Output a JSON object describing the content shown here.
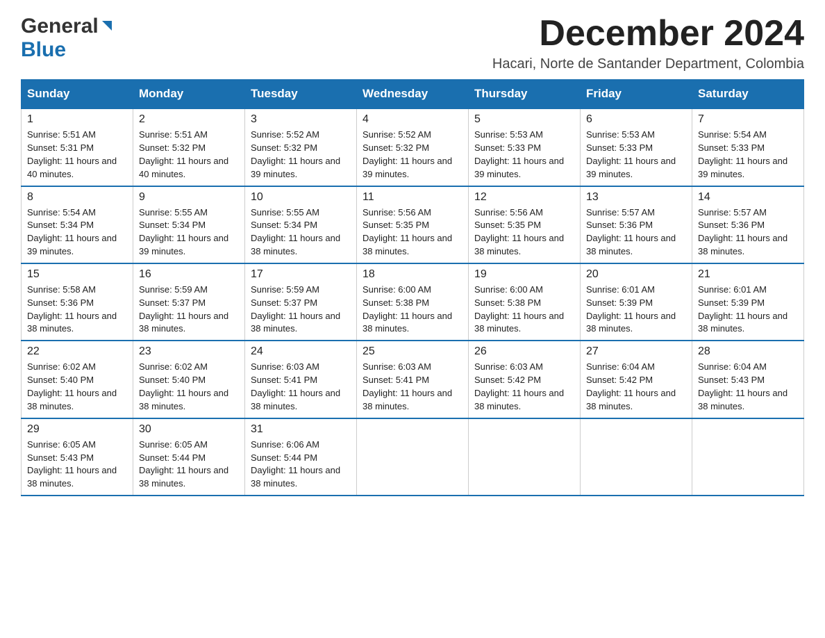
{
  "header": {
    "logo_line1": "General",
    "logo_line2": "Blue",
    "month_title": "December 2024",
    "location": "Hacari, Norte de Santander Department, Colombia"
  },
  "weekdays": [
    "Sunday",
    "Monday",
    "Tuesday",
    "Wednesday",
    "Thursday",
    "Friday",
    "Saturday"
  ],
  "weeks": [
    [
      {
        "day": "1",
        "sunrise": "Sunrise: 5:51 AM",
        "sunset": "Sunset: 5:31 PM",
        "daylight": "Daylight: 11 hours and 40 minutes."
      },
      {
        "day": "2",
        "sunrise": "Sunrise: 5:51 AM",
        "sunset": "Sunset: 5:32 PM",
        "daylight": "Daylight: 11 hours and 40 minutes."
      },
      {
        "day": "3",
        "sunrise": "Sunrise: 5:52 AM",
        "sunset": "Sunset: 5:32 PM",
        "daylight": "Daylight: 11 hours and 39 minutes."
      },
      {
        "day": "4",
        "sunrise": "Sunrise: 5:52 AM",
        "sunset": "Sunset: 5:32 PM",
        "daylight": "Daylight: 11 hours and 39 minutes."
      },
      {
        "day": "5",
        "sunrise": "Sunrise: 5:53 AM",
        "sunset": "Sunset: 5:33 PM",
        "daylight": "Daylight: 11 hours and 39 minutes."
      },
      {
        "day": "6",
        "sunrise": "Sunrise: 5:53 AM",
        "sunset": "Sunset: 5:33 PM",
        "daylight": "Daylight: 11 hours and 39 minutes."
      },
      {
        "day": "7",
        "sunrise": "Sunrise: 5:54 AM",
        "sunset": "Sunset: 5:33 PM",
        "daylight": "Daylight: 11 hours and 39 minutes."
      }
    ],
    [
      {
        "day": "8",
        "sunrise": "Sunrise: 5:54 AM",
        "sunset": "Sunset: 5:34 PM",
        "daylight": "Daylight: 11 hours and 39 minutes."
      },
      {
        "day": "9",
        "sunrise": "Sunrise: 5:55 AM",
        "sunset": "Sunset: 5:34 PM",
        "daylight": "Daylight: 11 hours and 39 minutes."
      },
      {
        "day": "10",
        "sunrise": "Sunrise: 5:55 AM",
        "sunset": "Sunset: 5:34 PM",
        "daylight": "Daylight: 11 hours and 38 minutes."
      },
      {
        "day": "11",
        "sunrise": "Sunrise: 5:56 AM",
        "sunset": "Sunset: 5:35 PM",
        "daylight": "Daylight: 11 hours and 38 minutes."
      },
      {
        "day": "12",
        "sunrise": "Sunrise: 5:56 AM",
        "sunset": "Sunset: 5:35 PM",
        "daylight": "Daylight: 11 hours and 38 minutes."
      },
      {
        "day": "13",
        "sunrise": "Sunrise: 5:57 AM",
        "sunset": "Sunset: 5:36 PM",
        "daylight": "Daylight: 11 hours and 38 minutes."
      },
      {
        "day": "14",
        "sunrise": "Sunrise: 5:57 AM",
        "sunset": "Sunset: 5:36 PM",
        "daylight": "Daylight: 11 hours and 38 minutes."
      }
    ],
    [
      {
        "day": "15",
        "sunrise": "Sunrise: 5:58 AM",
        "sunset": "Sunset: 5:36 PM",
        "daylight": "Daylight: 11 hours and 38 minutes."
      },
      {
        "day": "16",
        "sunrise": "Sunrise: 5:59 AM",
        "sunset": "Sunset: 5:37 PM",
        "daylight": "Daylight: 11 hours and 38 minutes."
      },
      {
        "day": "17",
        "sunrise": "Sunrise: 5:59 AM",
        "sunset": "Sunset: 5:37 PM",
        "daylight": "Daylight: 11 hours and 38 minutes."
      },
      {
        "day": "18",
        "sunrise": "Sunrise: 6:00 AM",
        "sunset": "Sunset: 5:38 PM",
        "daylight": "Daylight: 11 hours and 38 minutes."
      },
      {
        "day": "19",
        "sunrise": "Sunrise: 6:00 AM",
        "sunset": "Sunset: 5:38 PM",
        "daylight": "Daylight: 11 hours and 38 minutes."
      },
      {
        "day": "20",
        "sunrise": "Sunrise: 6:01 AM",
        "sunset": "Sunset: 5:39 PM",
        "daylight": "Daylight: 11 hours and 38 minutes."
      },
      {
        "day": "21",
        "sunrise": "Sunrise: 6:01 AM",
        "sunset": "Sunset: 5:39 PM",
        "daylight": "Daylight: 11 hours and 38 minutes."
      }
    ],
    [
      {
        "day": "22",
        "sunrise": "Sunrise: 6:02 AM",
        "sunset": "Sunset: 5:40 PM",
        "daylight": "Daylight: 11 hours and 38 minutes."
      },
      {
        "day": "23",
        "sunrise": "Sunrise: 6:02 AM",
        "sunset": "Sunset: 5:40 PM",
        "daylight": "Daylight: 11 hours and 38 minutes."
      },
      {
        "day": "24",
        "sunrise": "Sunrise: 6:03 AM",
        "sunset": "Sunset: 5:41 PM",
        "daylight": "Daylight: 11 hours and 38 minutes."
      },
      {
        "day": "25",
        "sunrise": "Sunrise: 6:03 AM",
        "sunset": "Sunset: 5:41 PM",
        "daylight": "Daylight: 11 hours and 38 minutes."
      },
      {
        "day": "26",
        "sunrise": "Sunrise: 6:03 AM",
        "sunset": "Sunset: 5:42 PM",
        "daylight": "Daylight: 11 hours and 38 minutes."
      },
      {
        "day": "27",
        "sunrise": "Sunrise: 6:04 AM",
        "sunset": "Sunset: 5:42 PM",
        "daylight": "Daylight: 11 hours and 38 minutes."
      },
      {
        "day": "28",
        "sunrise": "Sunrise: 6:04 AM",
        "sunset": "Sunset: 5:43 PM",
        "daylight": "Daylight: 11 hours and 38 minutes."
      }
    ],
    [
      {
        "day": "29",
        "sunrise": "Sunrise: 6:05 AM",
        "sunset": "Sunset: 5:43 PM",
        "daylight": "Daylight: 11 hours and 38 minutes."
      },
      {
        "day": "30",
        "sunrise": "Sunrise: 6:05 AM",
        "sunset": "Sunset: 5:44 PM",
        "daylight": "Daylight: 11 hours and 38 minutes."
      },
      {
        "day": "31",
        "sunrise": "Sunrise: 6:06 AM",
        "sunset": "Sunset: 5:44 PM",
        "daylight": "Daylight: 11 hours and 38 minutes."
      },
      null,
      null,
      null,
      null
    ]
  ]
}
